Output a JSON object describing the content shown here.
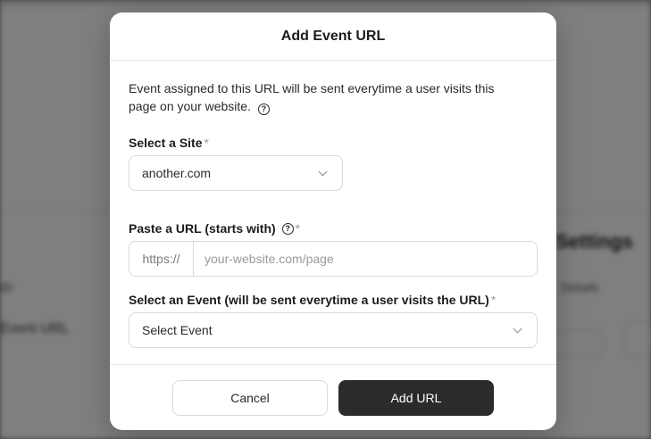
{
  "background": {
    "heading": "Settings",
    "sub_text": "Details",
    "left_text_1": "ID",
    "left_text_2": "Event URL"
  },
  "modal": {
    "title": "Add Event URL",
    "description": "Event assigned to this URL will be sent everytime a user visits this page on your website.",
    "help_icon": "question-circle-icon",
    "site": {
      "label": "Select a Site",
      "required_mark": "*",
      "selected": "another.com"
    },
    "url": {
      "label": "Paste a URL (starts with)",
      "required_mark": "*",
      "prefix": "https://",
      "placeholder": "your-website.com/page",
      "value": ""
    },
    "event": {
      "label": "Select an Event (will be sent everytime a user visits the URL)",
      "required_mark": "*",
      "selected": "Select Event"
    },
    "buttons": {
      "cancel": "Cancel",
      "add": "Add URL"
    }
  },
  "colors": {
    "primary_button": "#2b2b2b",
    "overlay": "rgba(0,0,0,0.5)",
    "border": "#d9d9d9",
    "required": "#9a9a9a"
  }
}
